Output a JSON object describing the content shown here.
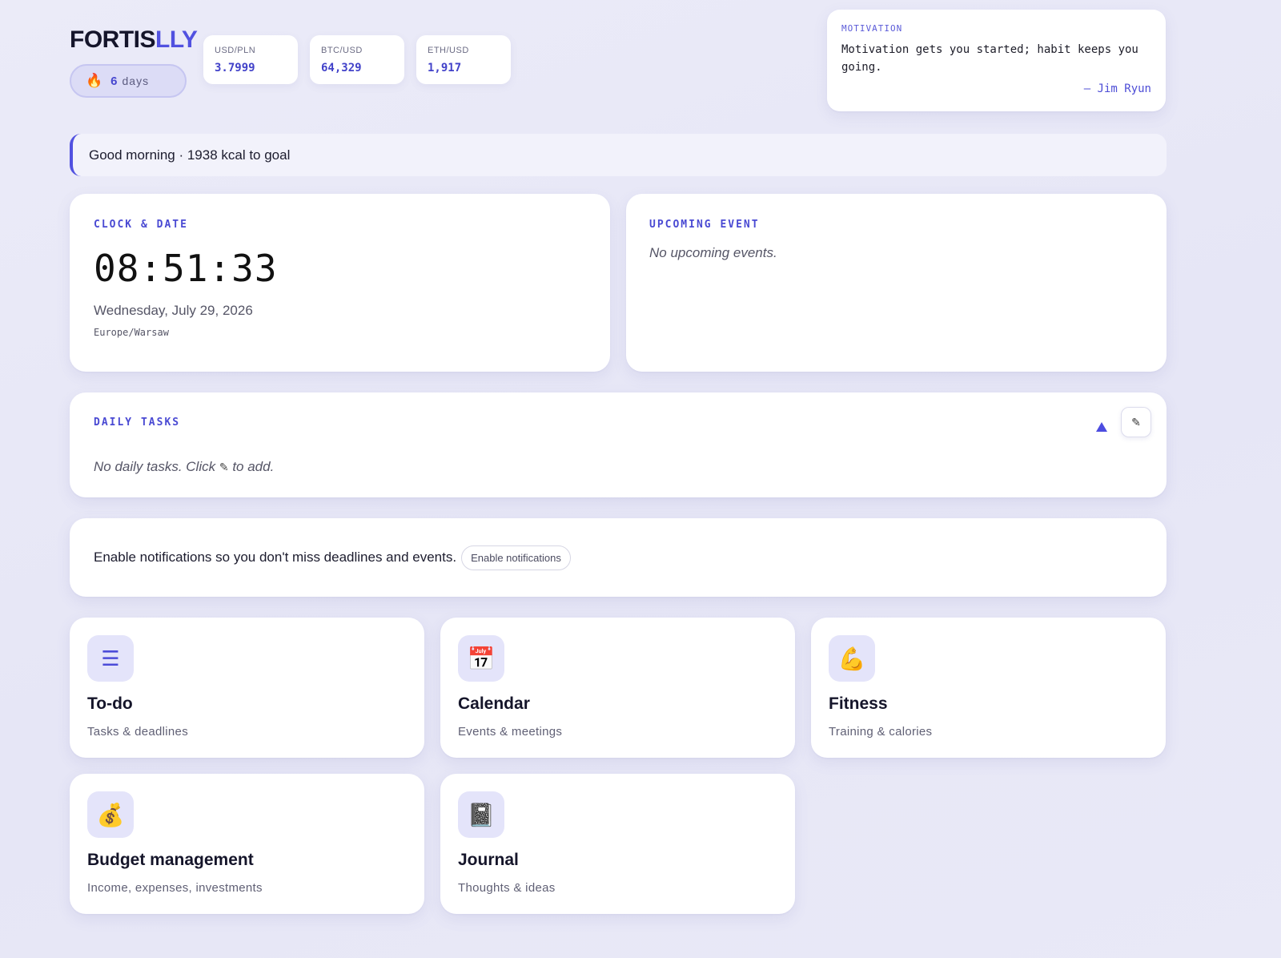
{
  "header": {
    "logo_main": "FORTIS",
    "logo_accent": "LLY",
    "streak": {
      "icon": "flame-icon",
      "value": "6",
      "label": "days"
    },
    "tickers": [
      {
        "pair": "USD/PLN",
        "value": "3.7999"
      },
      {
        "pair": "BTC/USD",
        "value": "64,329"
      },
      {
        "pair": "ETH/USD",
        "value": "1,917"
      }
    ],
    "motivation": {
      "tag": "MOTIVATION",
      "quote": "Motivation gets you started; habit keeps you going.",
      "author": "— Jim Ryun"
    }
  },
  "greeting": "Good morning · 1938 kcal to goal",
  "clock": {
    "title": "CLOCK & DATE",
    "time": "08:51:33",
    "date": "Wednesday, July 29, 2026",
    "timezone": "Europe/Warsaw"
  },
  "upcoming": {
    "title": "UPCOMING EVENT",
    "empty": "No upcoming events."
  },
  "daily_tasks": {
    "title": "DAILY TASKS",
    "empty_prefix": "No daily tasks. Click",
    "empty_icon": "✎",
    "empty_suffix": "to add.",
    "edit_icon": "✎"
  },
  "notifications": {
    "text": "Enable notifications so you don't miss deadlines and events.",
    "button": "Enable notifications"
  },
  "modules": [
    {
      "name": "To-do",
      "desc": "Tasks & deadlines",
      "icon": "☰",
      "icon_name": "list-icon"
    },
    {
      "name": "Calendar",
      "desc": "Events & meetings",
      "icon": "📅",
      "icon_name": "calendar-icon"
    },
    {
      "name": "Fitness",
      "desc": "Training & calories",
      "icon": "💪",
      "icon_name": "flexed-biceps-icon"
    },
    {
      "name": "Budget management",
      "desc": "Income, expenses, investments",
      "icon": "💰",
      "icon_name": "money-bag-icon"
    },
    {
      "name": "Journal",
      "desc": "Thoughts & ideas",
      "icon": "📓",
      "icon_name": "notebook-icon"
    }
  ],
  "colors": {
    "accent": "#5151e0",
    "background": "#e8e8f7",
    "card": "#ffffff"
  }
}
